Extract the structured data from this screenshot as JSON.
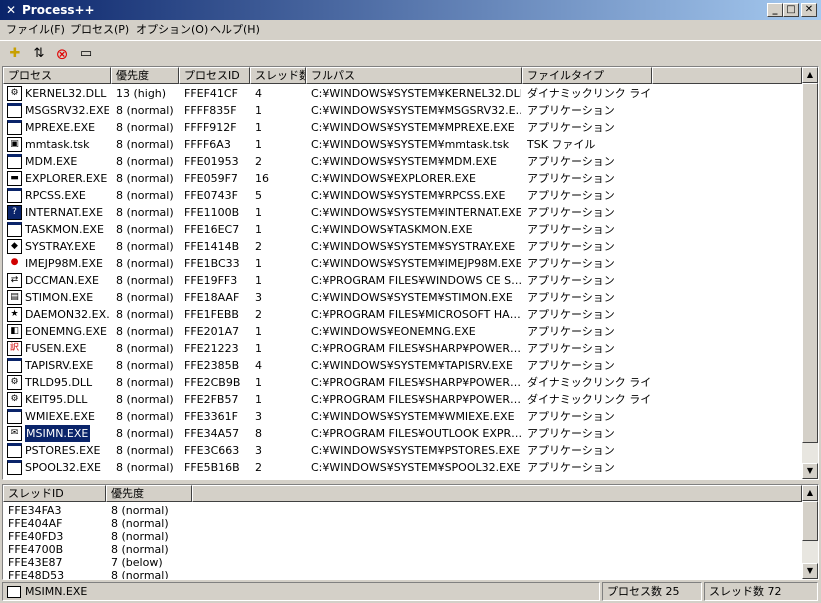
{
  "window": {
    "title": "Process++"
  },
  "menu": [
    "ファイル(F)",
    "プロセス(P)",
    "オプション(O)",
    "ヘルプ(H)"
  ],
  "toolbar": {
    "icons": [
      "new-process-icon",
      "sort-icon",
      "terminate-icon",
      "window-icon"
    ]
  },
  "process_columns": [
    "プロセス",
    "優先度",
    "プロセスID",
    "スレッド数",
    "フルパス",
    "ファイルタイプ"
  ],
  "processes": [
    {
      "name": "KERNEL32.DLL",
      "priority": "13 (high)",
      "pid": "FFEF41CF",
      "threads": "4",
      "path": "C:¥WINDOWS¥SYSTEM¥KERNEL32.DLL",
      "type": "ダイナミックリンク ライブ…",
      "icon": "dll-icon"
    },
    {
      "name": "MSGSRV32.EXE",
      "priority": "8 (normal)",
      "pid": "FFFF835F",
      "threads": "1",
      "path": "C:¥WINDOWS¥SYSTEM¥MSGSRV32.E…",
      "type": "アプリケーション",
      "icon": "window-app-icon"
    },
    {
      "name": "MPREXE.EXE",
      "priority": "8 (normal)",
      "pid": "FFFF912F",
      "threads": "1",
      "path": "C:¥WINDOWS¥SYSTEM¥MPREXE.EXE",
      "type": "アプリケーション",
      "icon": "window-app-icon"
    },
    {
      "name": "mmtask.tsk",
      "priority": "8 (normal)",
      "pid": "FFFF6A3",
      "threads": "1",
      "path": "C:¥WINDOWS¥SYSTEM¥mmtask.tsk",
      "type": "TSK ファイル",
      "icon": "task-file-icon"
    },
    {
      "name": "MDM.EXE",
      "priority": "8 (normal)",
      "pid": "FFE01953",
      "threads": "2",
      "path": "C:¥WINDOWS¥SYSTEM¥MDM.EXE",
      "type": "アプリケーション",
      "icon": "window-app-icon"
    },
    {
      "name": "EXPLORER.EXE",
      "priority": "8 (normal)",
      "pid": "FFE059F7",
      "threads": "16",
      "path": "C:¥WINDOWS¥EXPLORER.EXE",
      "type": "アプリケーション",
      "icon": "computer-icon"
    },
    {
      "name": "RPCSS.EXE",
      "priority": "8 (normal)",
      "pid": "FFE0743F",
      "threads": "5",
      "path": "C:¥WINDOWS¥SYSTEM¥RPCSS.EXE",
      "type": "アプリケーション",
      "icon": "window-app-icon"
    },
    {
      "name": "INTERNAT.EXE",
      "priority": "8 (normal)",
      "pid": "FFE1100B",
      "threads": "1",
      "path": "C:¥WINDOWS¥SYSTEM¥INTERNAT.EXE",
      "type": "アプリケーション",
      "icon": "help-icon"
    },
    {
      "name": "TASKMON.EXE",
      "priority": "8 (normal)",
      "pid": "FFE16EC7",
      "threads": "1",
      "path": "C:¥WINDOWS¥TASKMON.EXE",
      "type": "アプリケーション",
      "icon": "window-app-icon"
    },
    {
      "name": "SYSTRAY.EXE",
      "priority": "8 (normal)",
      "pid": "FFE1414B",
      "threads": "2",
      "path": "C:¥WINDOWS¥SYSTEM¥SYSTRAY.EXE",
      "type": "アプリケーション",
      "icon": "tray-icon"
    },
    {
      "name": "IMEJP98M.EXE",
      "priority": "8 (normal)",
      "pid": "FFE1BC33",
      "threads": "1",
      "path": "C:¥WINDOWS¥SYSTEM¥IMEJP98M.EXE",
      "type": "アプリケーション",
      "icon": "ime-icon"
    },
    {
      "name": "DCCMAN.EXE",
      "priority": "8 (normal)",
      "pid": "FFE19FF3",
      "threads": "1",
      "path": "C:¥PROGRAM FILES¥WINDOWS CE S…",
      "type": "アプリケーション",
      "icon": "sync-icon"
    },
    {
      "name": "STIMON.EXE",
      "priority": "8 (normal)",
      "pid": "FFE18AAF",
      "threads": "3",
      "path": "C:¥WINDOWS¥SYSTEM¥STIMON.EXE",
      "type": "アプリケーション",
      "icon": "scanner-icon"
    },
    {
      "name": "DAEMON32.EX…",
      "priority": "8 (normal)",
      "pid": "FFE1FEBB",
      "threads": "2",
      "path": "C:¥PROGRAM FILES¥MICROSOFT HA…",
      "type": "アプリケーション",
      "icon": "daemon-icon"
    },
    {
      "name": "EONEMNG.EXE",
      "priority": "8 (normal)",
      "pid": "FFE201A7",
      "threads": "1",
      "path": "C:¥WINDOWS¥EONEMNG.EXE",
      "type": "アプリケーション",
      "icon": "eone-icon"
    },
    {
      "name": "FUSEN.EXE",
      "priority": "8 (normal)",
      "pid": "FFE21223",
      "threads": "1",
      "path": "C:¥PROGRAM FILES¥SHARP¥POWER…",
      "type": "アプリケーション",
      "icon": "note-icon"
    },
    {
      "name": "TAPISRV.EXE",
      "priority": "8 (normal)",
      "pid": "FFE2385B",
      "threads": "4",
      "path": "C:¥WINDOWS¥SYSTEM¥TAPISRV.EXE",
      "type": "アプリケーション",
      "icon": "window-app-icon"
    },
    {
      "name": "TRLD95.DLL",
      "priority": "8 (normal)",
      "pid": "FFE2CB9B",
      "threads": "1",
      "path": "C:¥PROGRAM FILES¥SHARP¥POWER…",
      "type": "ダイナミックリンク ライブ…",
      "icon": "dll-icon"
    },
    {
      "name": "KEIT95.DLL",
      "priority": "8 (normal)",
      "pid": "FFE2FB57",
      "threads": "1",
      "path": "C:¥PROGRAM FILES¥SHARP¥POWER…",
      "type": "ダイナミックリンク ライブ…",
      "icon": "dll-icon"
    },
    {
      "name": "WMIEXE.EXE",
      "priority": "8 (normal)",
      "pid": "FFE3361F",
      "threads": "3",
      "path": "C:¥WINDOWS¥SYSTEM¥WMIEXE.EXE",
      "type": "アプリケーション",
      "icon": "window-app-icon"
    },
    {
      "name": "MSIMN.EXE",
      "priority": "8 (normal)",
      "pid": "FFE34A57",
      "threads": "8",
      "path": "C:¥PROGRAM FILES¥OUTLOOK EXPR…",
      "type": "アプリケーション",
      "icon": "mail-icon",
      "selected": true
    },
    {
      "name": "PSTORES.EXE",
      "priority": "8 (normal)",
      "pid": "FFE3C663",
      "threads": "3",
      "path": "C:¥WINDOWS¥SYSTEM¥PSTORES.EXE",
      "type": "アプリケーション",
      "icon": "window-app-icon"
    },
    {
      "name": "SPOOL32.EXE",
      "priority": "8 (normal)",
      "pid": "FFE5B16B",
      "threads": "2",
      "path": "C:¥WINDOWS¥SYSTEM¥SPOOL32.EXE",
      "type": "アプリケーション",
      "icon": "window-app-icon"
    }
  ],
  "thread_columns": [
    "スレッドID",
    "優先度"
  ],
  "threads": [
    {
      "id": "FFE34FA3",
      "priority": "8 (normal)"
    },
    {
      "id": "FFE404AF",
      "priority": "8 (normal)"
    },
    {
      "id": "FFE40FD3",
      "priority": "8 (normal)"
    },
    {
      "id": "FFE4700B",
      "priority": "8 (normal)"
    },
    {
      "id": "FFE43E87",
      "priority": "7 (below)"
    },
    {
      "id": "FFE48D53",
      "priority": "8 (normal)"
    }
  ],
  "statusbar": {
    "selected": "MSIMN.EXE",
    "process_count": "プロセス数 25",
    "thread_count": "スレッド数 72"
  }
}
